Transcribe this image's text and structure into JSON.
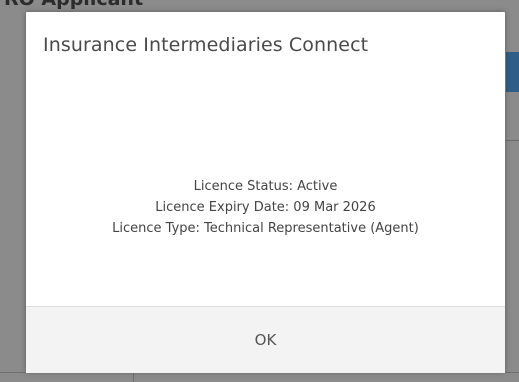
{
  "background": {
    "title": "RO Applicant"
  },
  "modal": {
    "title": "Insurance Intermediaries Connect",
    "lines": [
      "Licence Status: Active",
      "Licence Expiry Date:  09 Mar 2026",
      "Licence Type: Technical Representative (Agent)"
    ],
    "ok_label": "OK"
  }
}
